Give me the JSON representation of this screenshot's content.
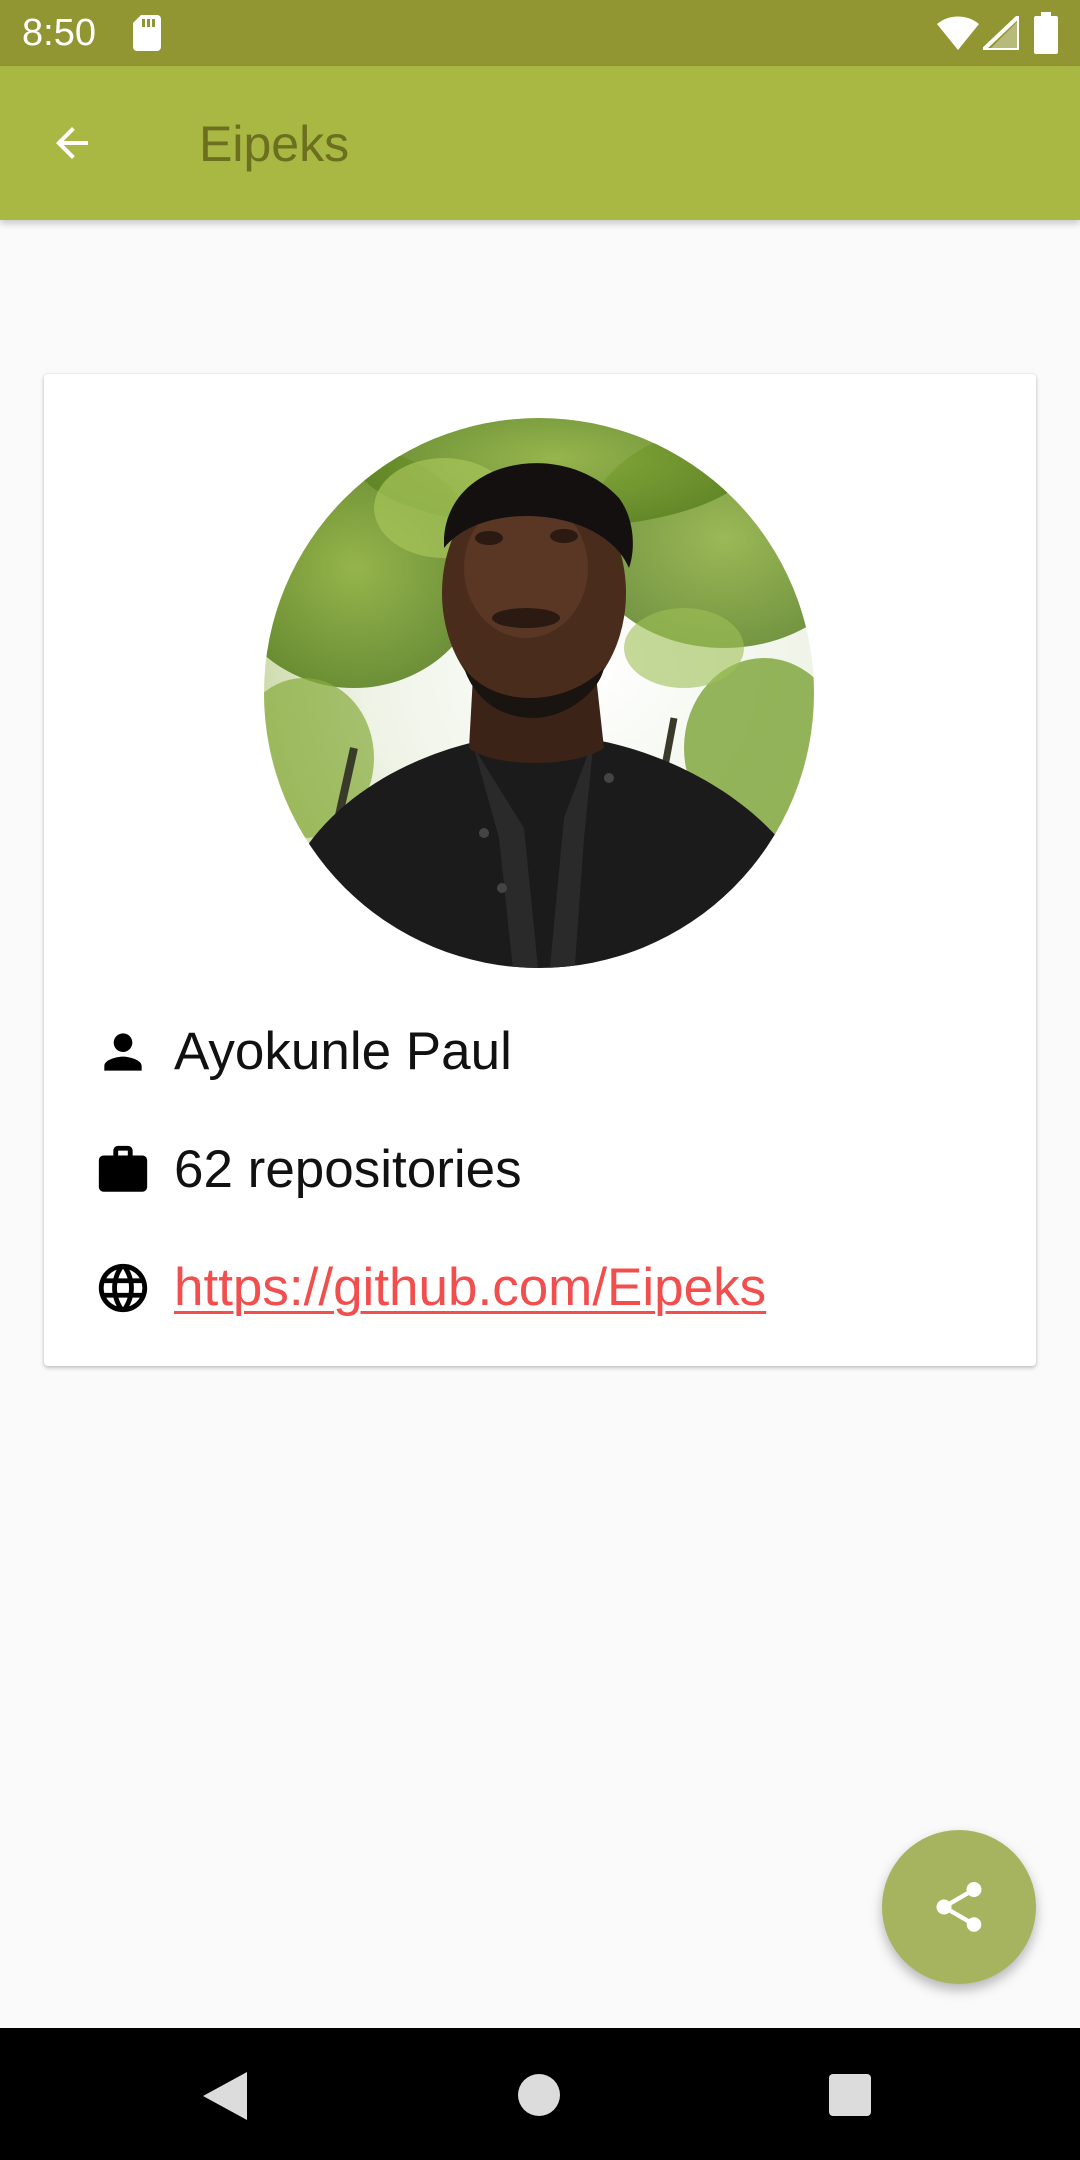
{
  "status_bar": {
    "time": "8:50",
    "icons": [
      "sd-card-icon",
      "wifi-icon",
      "signal-icon",
      "battery-icon"
    ]
  },
  "app_bar": {
    "title": "Eipeks",
    "back_icon": "arrow-back-icon"
  },
  "profile": {
    "avatar": "profile-photo",
    "name": "Ayokunle Paul",
    "repositories": "62 repositories",
    "url": "https://github.com/Eipeks",
    "icons": {
      "name": "person-icon",
      "repositories": "briefcase-icon",
      "url": "globe-icon"
    }
  },
  "fab": {
    "icon": "share-icon"
  },
  "nav_bar": {
    "icons": [
      "nav-back-icon",
      "nav-home-icon",
      "nav-recents-icon"
    ]
  },
  "colors": {
    "status_bar": "#919532",
    "app_bar": "#a8b843",
    "app_title": "#6b6f1f",
    "link": "#f24e4e",
    "fab": "#a7b45f",
    "background": "#fafafa"
  }
}
